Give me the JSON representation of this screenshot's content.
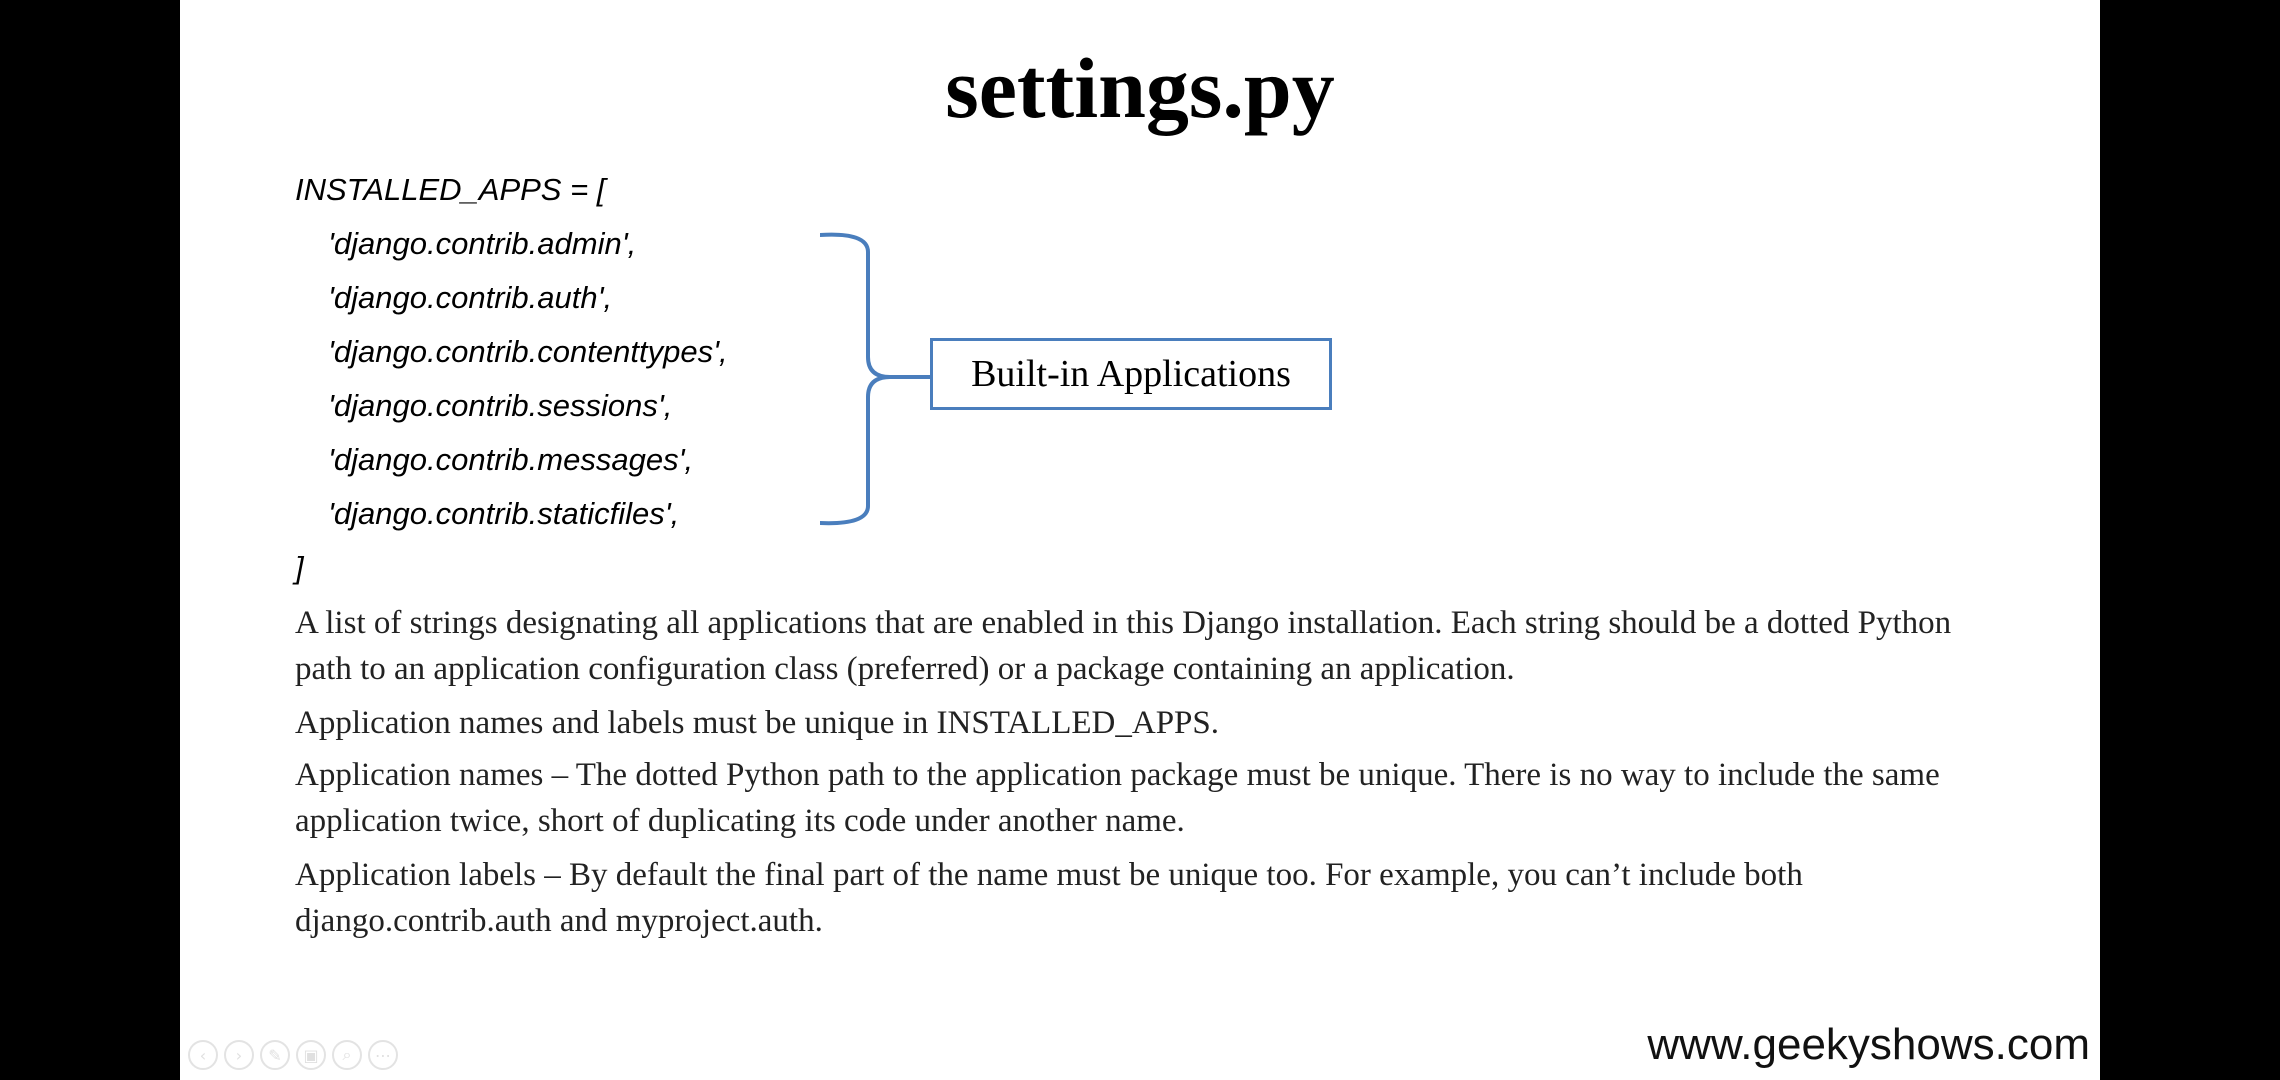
{
  "slide": {
    "title": "settings.py",
    "code_lines": [
      "INSTALLED_APPS = [",
      "'django.contrib.admin',",
      "'django.contrib.auth',",
      "'django.contrib.contenttypes',",
      "'django.contrib.sessions',",
      "'django.contrib.messages',",
      "'django.contrib.staticfiles',",
      "]"
    ],
    "callout_label": "Built-in Applications",
    "paragraphs": [
      "A list of strings designating all applications that are enabled in this Django installation. Each string should be a dotted Python path to an application configuration class (preferred) or a package containing an application.",
      "Application names and labels must be unique in INSTALLED_APPS.",
      "Application names – The dotted Python path to the application package must be unique. There is no way to include the same application twice, short of duplicating its code under another name.",
      "Application labels – By default the final part of the name must be unique too. For example, you can’t include both django.contrib.auth and myproject.auth."
    ],
    "watermark": "www.geekyshows.com",
    "brace_color": "#4a7ebd"
  },
  "controls": {
    "icons": [
      "previous-icon",
      "next-icon",
      "pen-icon",
      "slides-icon",
      "zoom-icon",
      "more-icon"
    ],
    "glyphs": [
      "‹",
      "›",
      "✎",
      "▣",
      "⌕",
      "⋯"
    ]
  }
}
